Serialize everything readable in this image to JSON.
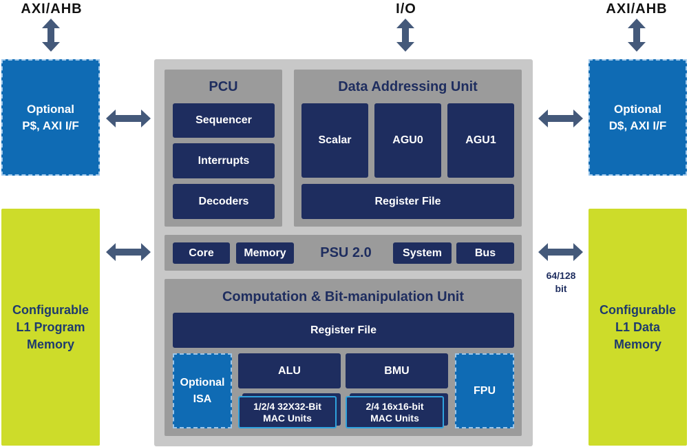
{
  "top_labels": {
    "left": "AXI/AHB",
    "center": "I/O",
    "right": "AXI/AHB"
  },
  "left": {
    "cache": "Optional\nP$, AXI I/F",
    "memory": "Configurable\nL1 Program\nMemory"
  },
  "right": {
    "cache": "Optional\nD$, AXI I/F",
    "memory": "Configurable\nL1 Data\nMemory",
    "bus_width": "64/128\nbit"
  },
  "pcu": {
    "title": "PCU",
    "items": [
      "Sequencer",
      "Interrupts",
      "Decoders"
    ]
  },
  "dau": {
    "title": "Data Addressing Unit",
    "units": [
      "Scalar",
      "AGU0",
      "AGU1"
    ],
    "register_file": "Register File"
  },
  "psu": {
    "title": "PSU 2.0",
    "items": [
      "Core",
      "Memory",
      "System",
      "Bus"
    ]
  },
  "cbu": {
    "title": "Computation & Bit-manipulation Unit",
    "register_file": "Register File",
    "optional_isa": "Optional\nISA",
    "alu": "ALU",
    "bmu": "BMU",
    "mac32": "1/2/4 32X32-Bit\nMAC Units",
    "mac16": "2/4 16x16-bit\nMAC Units",
    "fpu": "FPU"
  },
  "colors": {
    "navy": "#1e2d5f",
    "blue": "#0f6bb4",
    "lime": "#cddc2a",
    "arrow": "#44597a",
    "outer": "#c8c8c8",
    "panel": "#9b9b9b"
  }
}
